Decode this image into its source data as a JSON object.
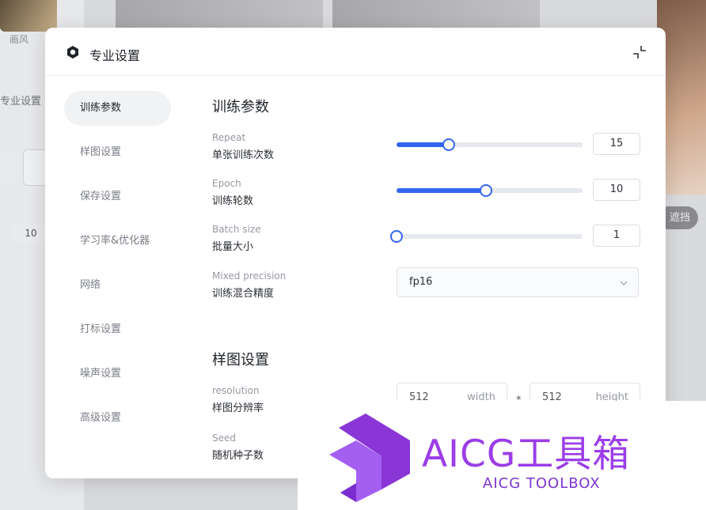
{
  "background": {
    "left_label": "画风",
    "pro_label": "专业设置",
    "num_value": "10",
    "button_label": "遮挡"
  },
  "modal": {
    "title": "专业设置",
    "nav": [
      {
        "label": "训练参数",
        "active": true
      },
      {
        "label": "样图设置",
        "active": false
      },
      {
        "label": "保存设置",
        "active": false
      },
      {
        "label": "学习率&优化器",
        "active": false
      },
      {
        "label": "网络",
        "active": false
      },
      {
        "label": "打标设置",
        "active": false
      },
      {
        "label": "噪声设置",
        "active": false
      },
      {
        "label": "高级设置",
        "active": false
      }
    ],
    "training": {
      "title": "训练参数",
      "repeat": {
        "en": "Repeat",
        "cn": "单张训练次数",
        "value": "15",
        "level_percent": 28
      },
      "epoch": {
        "en": "Epoch",
        "cn": "训练轮数",
        "value": "10",
        "level_percent": 48
      },
      "batch": {
        "en": "Batch size",
        "cn": "批量大小",
        "value": "1",
        "level_percent": 0
      },
      "precision": {
        "en": "Mixed precision",
        "cn": "训练混合精度",
        "value": "fp16"
      }
    },
    "sample": {
      "title": "样图设置",
      "resolution": {
        "en": "resolution",
        "cn": "样图分辨率",
        "width": "512",
        "width_unit": "width",
        "sep": "*",
        "height": "512",
        "height_unit": "height"
      },
      "seed": {
        "en": "Seed",
        "cn": "随机种子数"
      }
    }
  },
  "watermark": {
    "title": "AICG工具箱",
    "subtitle": "AICG TOOLBOX",
    "color": "#9b3de8"
  }
}
